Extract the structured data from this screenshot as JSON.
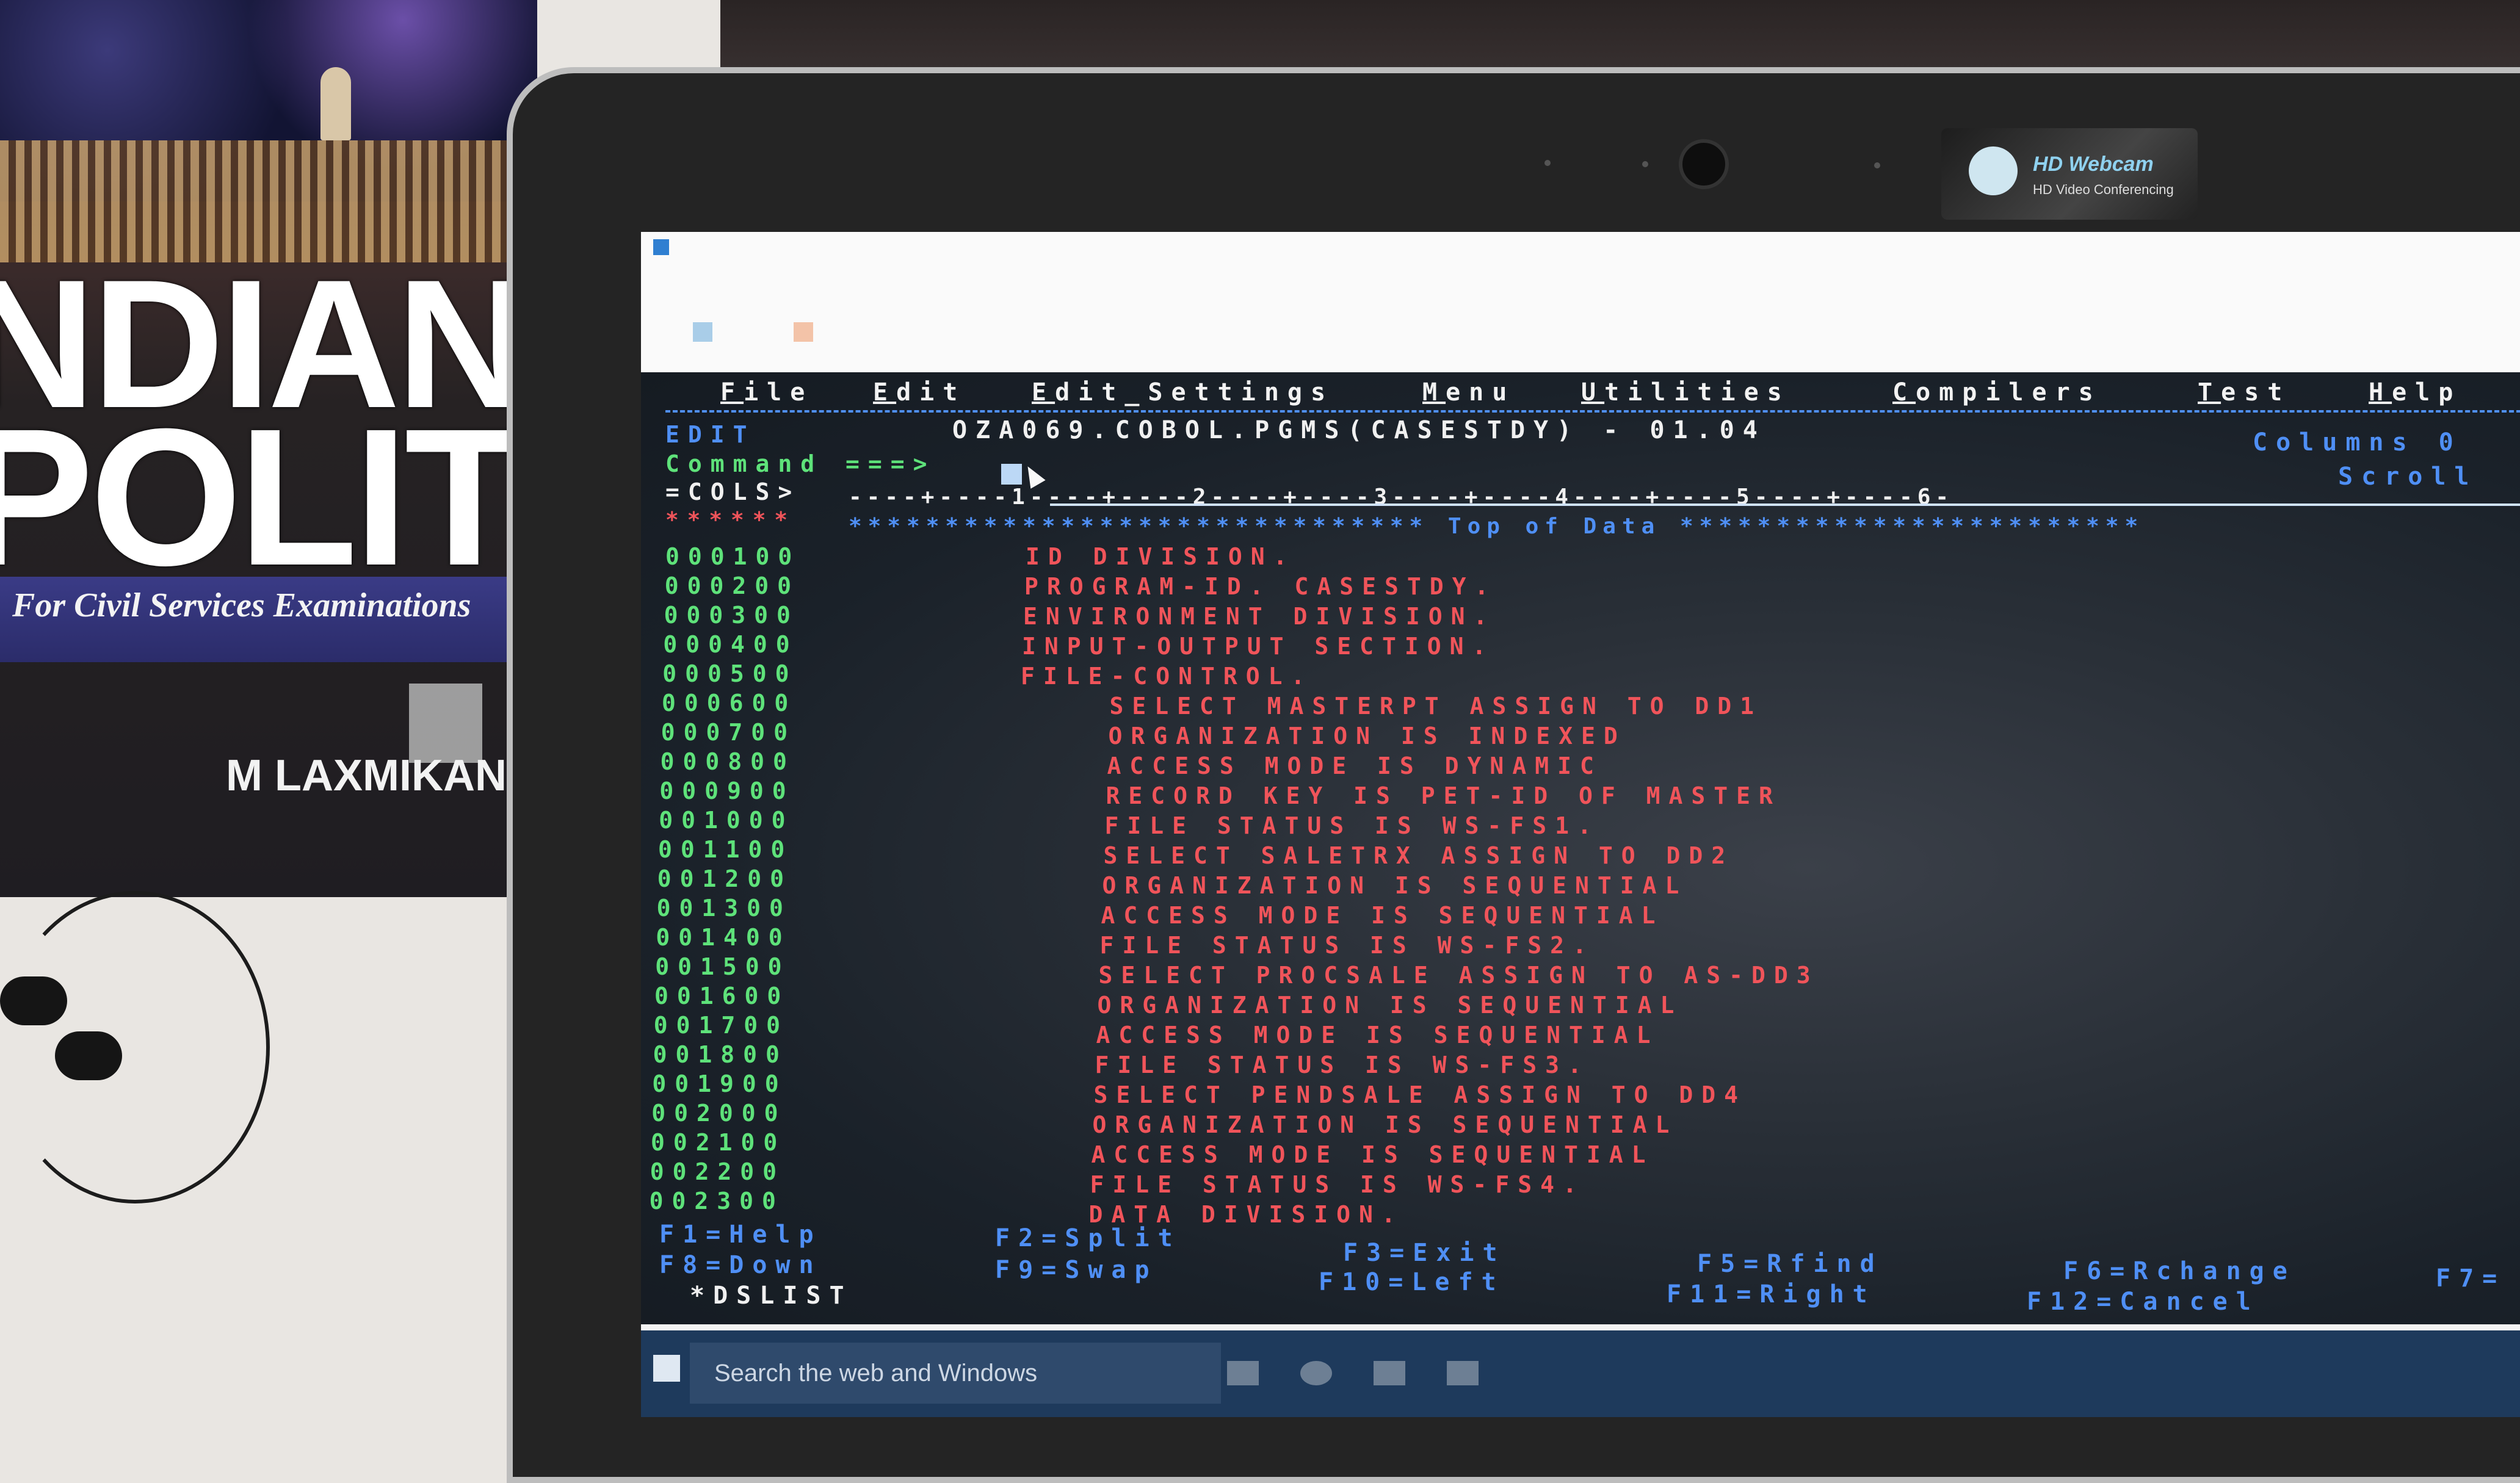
{
  "book": {
    "title_line1": "NDIAN",
    "title_line2": "POLITY",
    "subtitle": "For Civil Services Examinations",
    "author": "M LAXMIKANT"
  },
  "webcam": {
    "brand": "HD Webcam",
    "tagline": "HD Video Conferencing"
  },
  "ispf": {
    "menu": [
      {
        "key": "F",
        "rest": "ile"
      },
      {
        "key": "E",
        "rest": "dit"
      },
      {
        "key": "E",
        "rest": "dit_Settings"
      },
      {
        "key": "M",
        "rest": "enu"
      },
      {
        "key": "U",
        "rest": "tilities"
      },
      {
        "key": "C",
        "rest": "ompilers"
      },
      {
        "key": "T",
        "rest": "est"
      },
      {
        "key": "H",
        "rest": "elp"
      }
    ],
    "mode": "EDIT",
    "dataset": "OZA069.COBOL.PGMS(CASESTDY) - 01.04",
    "columns_label": "Columns 0",
    "command_label": "Command ===>",
    "scroll_label": "Scroll",
    "cols_label": "=COLS>",
    "ruler": "----+----1----+----2----+----3----+----4----+----5----+----6-",
    "stars_prefix": "******",
    "top_of_data": "****************************** Top of Data ************************",
    "lines": [
      {
        "num": "000100",
        "text": "ID DIVISION."
      },
      {
        "num": "000200",
        "text": "PROGRAM-ID. CASESTDY."
      },
      {
        "num": "000300",
        "text": "ENVIRONMENT DIVISION."
      },
      {
        "num": "000400",
        "text": "INPUT-OUTPUT SECTION."
      },
      {
        "num": "000500",
        "text": "FILE-CONTROL."
      },
      {
        "num": "000600",
        "text": "    SELECT MASTERPT ASSIGN TO DD1"
      },
      {
        "num": "000700",
        "text": "    ORGANIZATION IS INDEXED"
      },
      {
        "num": "000800",
        "text": "    ACCESS MODE IS DYNAMIC"
      },
      {
        "num": "000900",
        "text": "    RECORD KEY IS PET-ID OF MASTER"
      },
      {
        "num": "001000",
        "text": "    FILE STATUS IS WS-FS1."
      },
      {
        "num": "001100",
        "text": "    SELECT SALETRX ASSIGN TO DD2"
      },
      {
        "num": "001200",
        "text": "    ORGANIZATION IS SEQUENTIAL"
      },
      {
        "num": "001300",
        "text": "    ACCESS MODE IS SEQUENTIAL"
      },
      {
        "num": "001400",
        "text": "    FILE STATUS IS WS-FS2."
      },
      {
        "num": "001500",
        "text": "    SELECT PROCSALE ASSIGN TO AS-DD3"
      },
      {
        "num": "001600",
        "text": "    ORGANIZATION IS SEQUENTIAL"
      },
      {
        "num": "001700",
        "text": "    ACCESS MODE IS SEQUENTIAL"
      },
      {
        "num": "001800",
        "text": "    FILE STATUS IS WS-FS3."
      },
      {
        "num": "001900",
        "text": "    SELECT PENDSALE ASSIGN TO DD4"
      },
      {
        "num": "002000",
        "text": "    ORGANIZATION IS SEQUENTIAL"
      },
      {
        "num": "002100",
        "text": "    ACCESS MODE IS SEQUENTIAL"
      },
      {
        "num": "002200",
        "text": "    FILE STATUS IS WS-FS4."
      },
      {
        "num": "002300",
        "text": "    DATA DIVISION."
      }
    ],
    "fkeys_row1": [
      "F1=Help",
      "F2=Split",
      "F3=Exit",
      "F5=Rfind",
      "F6=Rchange",
      "F7="
    ],
    "fkeys_row2": [
      "F8=Down",
      "F9=Swap",
      "F10=Left",
      "F11=Right",
      "F12=Cancel"
    ],
    "dslist": "*DSLIST"
  },
  "taskbar": {
    "search_placeholder": "Search the web and Windows"
  }
}
